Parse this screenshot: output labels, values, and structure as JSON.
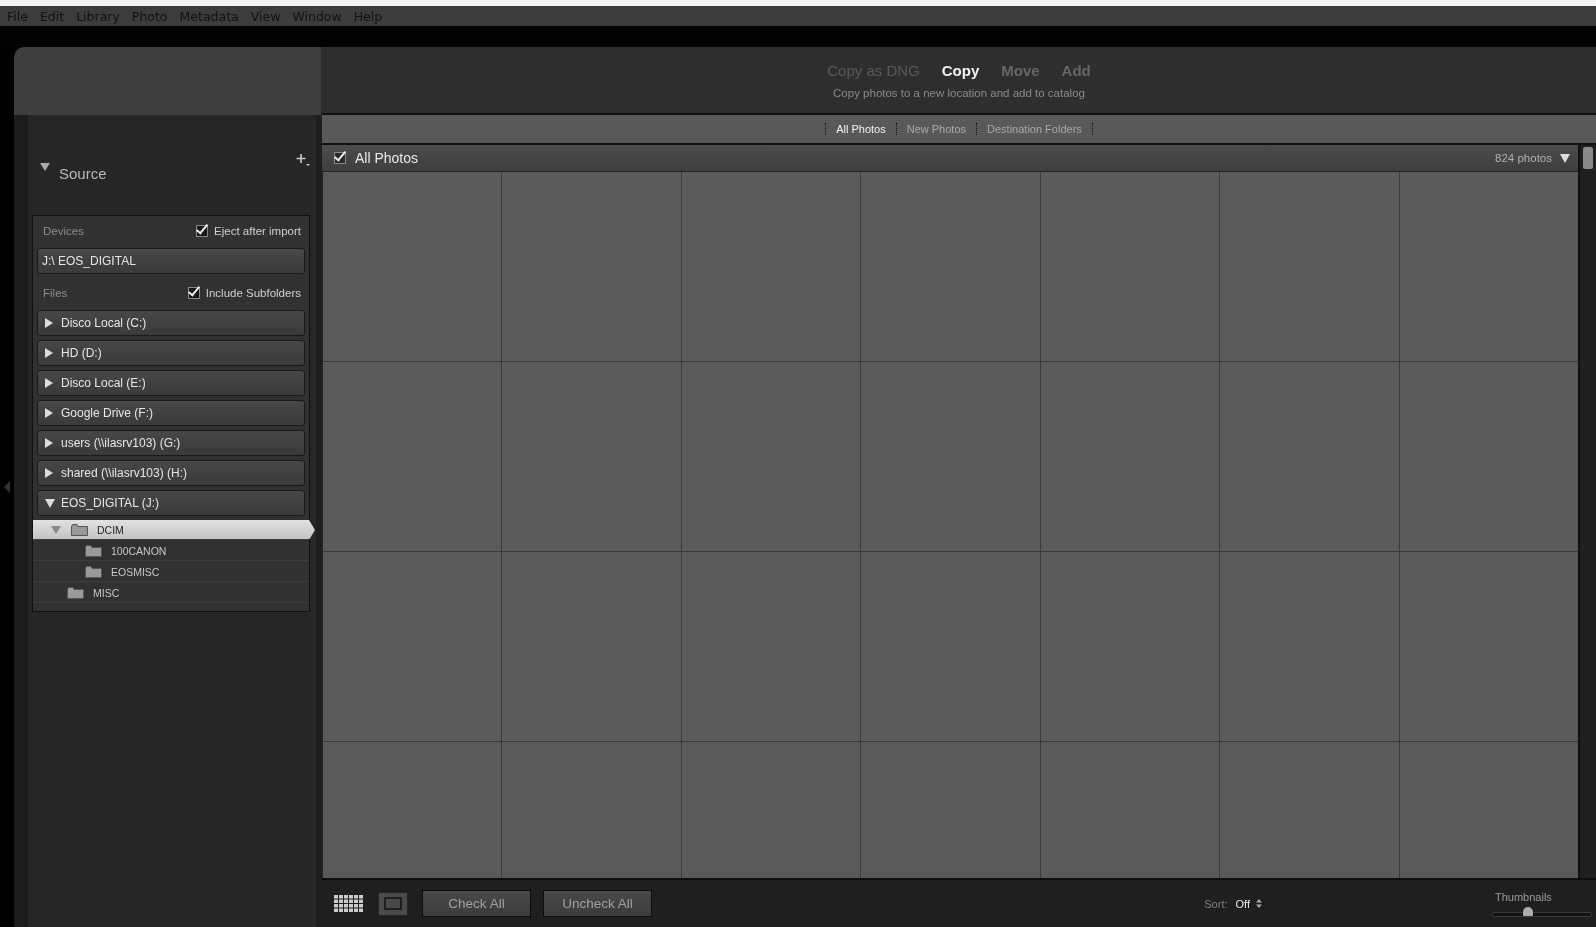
{
  "menu_bar": [
    "File",
    "Edit",
    "Library",
    "Photo",
    "Metadata",
    "View",
    "Window",
    "Help"
  ],
  "import_modes": [
    {
      "label": "Copy as DNG",
      "selected": false
    },
    {
      "label": "Copy",
      "selected": true
    },
    {
      "label": "Move",
      "selected": false
    },
    {
      "label": "Add",
      "selected": false
    }
  ],
  "mode_description": "Copy photos to a new location and add to catalog",
  "source_panel": {
    "title": "Source",
    "expanded": true,
    "devices_label": "Devices",
    "eject_after_import": {
      "label": "Eject after import",
      "checked": true
    },
    "device": "J:\\ EOS_DIGITAL",
    "files_label": "Files",
    "include_subfolders": {
      "label": "Include Subfolders",
      "checked": true
    },
    "volumes": [
      {
        "label": "Disco Local (C:)",
        "expanded": false
      },
      {
        "label": "HD (D:)",
        "expanded": false
      },
      {
        "label": "Disco Local (E:)",
        "expanded": false
      },
      {
        "label": "Google Drive (F:)",
        "expanded": false
      },
      {
        "label": "users (\\\\ilasrv103) (G:)",
        "expanded": false
      },
      {
        "label": "shared (\\\\ilasrv103) (H:)",
        "expanded": false
      },
      {
        "label": "EOS_DIGITAL (J:)",
        "expanded": true,
        "children": [
          {
            "label": "DCIM",
            "selected": true,
            "expanded": true,
            "children": [
              {
                "label": "100CANON",
                "selected": false
              },
              {
                "label": "EOSMISC",
                "selected": false
              }
            ]
          },
          {
            "label": "MISC",
            "selected": false
          }
        ]
      }
    ]
  },
  "filter_tabs": [
    {
      "label": "All Photos",
      "selected": true
    },
    {
      "label": "New Photos",
      "selected": false
    },
    {
      "label": "Destination Folders",
      "selected": false
    }
  ],
  "grid_header": {
    "title": "All Photos",
    "checked": true,
    "count": "824 photos"
  },
  "toolbar": {
    "buttons": [
      "Check All",
      "Uncheck All"
    ],
    "sort_label": "Sort:",
    "sort_value": "Off",
    "thumbnails_label": "Thumbnails",
    "thumbnail_size": {
      "level": 0.36
    }
  }
}
